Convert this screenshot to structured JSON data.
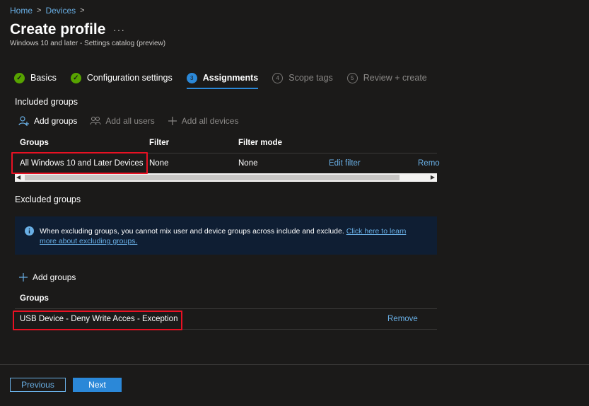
{
  "breadcrumb": {
    "items": [
      "Home",
      "Devices"
    ],
    "separator": ">"
  },
  "header": {
    "title": "Create profile",
    "more": "···",
    "subtitle": "Windows 10 and later - Settings catalog (preview)"
  },
  "steps": [
    {
      "number": "✓",
      "label": "Basics",
      "state": "done"
    },
    {
      "number": "✓",
      "label": "Configuration settings",
      "state": "done"
    },
    {
      "number": "3",
      "label": "Assignments",
      "state": "active"
    },
    {
      "number": "4",
      "label": "Scope tags",
      "state": "future"
    },
    {
      "number": "5",
      "label": "Review + create",
      "state": "future"
    }
  ],
  "included": {
    "title": "Included groups",
    "commands": {
      "add_groups": "Add groups",
      "add_all_users": "Add all users",
      "add_all_devices": "Add all devices"
    },
    "columns": [
      "Groups",
      "Filter",
      "Filter mode"
    ],
    "rows": [
      {
        "group": "All Windows 10 and Later Devices",
        "filter": "None",
        "filter_mode": "None",
        "edit_filter": "Edit filter",
        "remove": "Remo"
      }
    ]
  },
  "excluded": {
    "title": "Excluded groups",
    "info": {
      "text": "When excluding groups, you cannot mix user and device groups across include and exclude.",
      "link": "Click here to learn more about excluding groups."
    },
    "add_groups": "Add groups",
    "column": "Groups",
    "rows": [
      {
        "group": "USB Device - Deny Write Acces - Exception",
        "remove": "Remove"
      }
    ]
  },
  "footer": {
    "previous": "Previous",
    "next": "Next"
  },
  "colors": {
    "background": "#1b1a19",
    "accent": "#2b88d8",
    "link": "#69afe5",
    "success": "#57a300",
    "highlight": "#e81123",
    "info_bg": "#0f1e33"
  }
}
